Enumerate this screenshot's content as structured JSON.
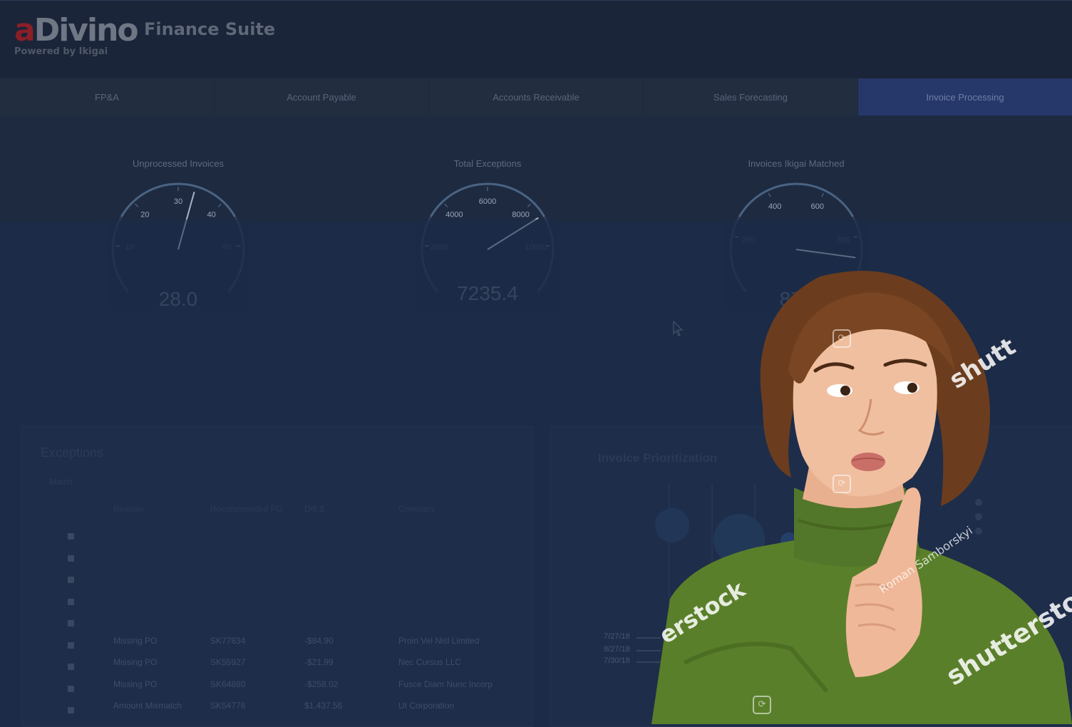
{
  "header": {
    "logo_a": "a",
    "logo_divino": "Divino",
    "suite": "Finance Suite",
    "powered_by": "Powered by Ikigai"
  },
  "tabs": [
    {
      "label": "FP&A",
      "active": false
    },
    {
      "label": "Account Payable",
      "active": false
    },
    {
      "label": "Accounts Receivable",
      "active": false
    },
    {
      "label": "Sales Forecasting",
      "active": false
    },
    {
      "label": "Invoice Processing",
      "active": true
    }
  ],
  "gauges": [
    {
      "title": "Unprocessed Invoices",
      "value": "28.0",
      "ticks": [
        "10",
        "20",
        "30",
        "40",
        "50"
      ],
      "needle": 28
    },
    {
      "title": "Total Exceptions",
      "value": "7235.4",
      "ticks": [
        "2000",
        "4000",
        "6000",
        "8000",
        "10000"
      ],
      "needle": 7235.4
    },
    {
      "title": "Invoices Ikigai Matched",
      "value": "876",
      "ticks": [
        "200",
        "400",
        "600",
        "800"
      ],
      "needle": 876
    }
  ],
  "exceptions": {
    "title": "Exceptions",
    "match_label": "Match",
    "columns": [
      "Reason",
      "Recommended PO",
      "Diff $",
      "Company"
    ],
    "rows": [
      [
        "",
        "",
        "",
        ""
      ],
      [
        "",
        "",
        "",
        ""
      ],
      [
        "",
        "",
        "",
        ""
      ],
      [
        "",
        "",
        "",
        ""
      ],
      [
        "",
        "",
        "",
        ""
      ],
      [
        "Missing PO",
        "SK77834",
        "-$84.90",
        "Proin Vel Nisl Limited"
      ],
      [
        "Missing PO",
        "SK55927",
        "-$21.99",
        "Nec Cursus LLC"
      ],
      [
        "Missing PO",
        "SK64880",
        "-$258.02",
        "Fusce Diam Nunc Incorp"
      ],
      [
        "Amount Mismatch",
        "SK54776",
        "$1,437.56",
        "Ut Corporation"
      ]
    ]
  },
  "prioritization": {
    "title": "Invoice Prioritization",
    "dates": [
      "7/27/18",
      "8/27/18",
      "7/30/18"
    ]
  },
  "watermarks": {
    "brand": "shutterstock",
    "partial_top": "shutt",
    "partial_left": "erstock",
    "credit": "Roman Samborskyi"
  },
  "colors": {
    "background": "#1c2b47",
    "active_tab": "#26386a",
    "logo_red": "#8b1e27",
    "sweater_green": "#5a7f2a"
  }
}
